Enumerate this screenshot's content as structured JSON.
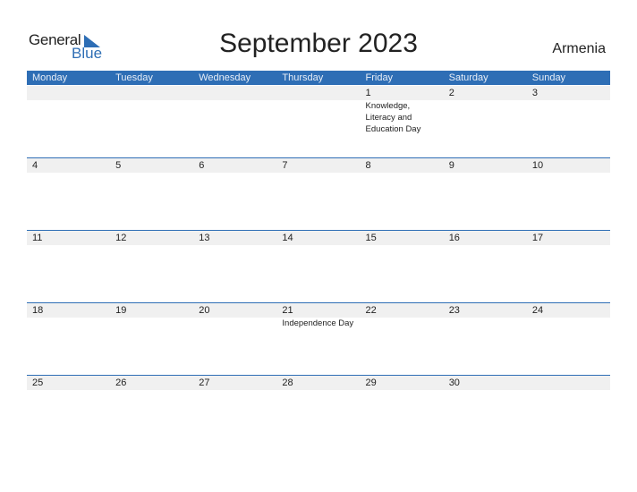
{
  "logo": {
    "general": "General",
    "blue": "Blue",
    "icon": "triangle-flag-icon"
  },
  "title": "September 2023",
  "country": "Armenia",
  "colors": {
    "accent": "#2e6eb5",
    "strip": "#f0f0f0"
  },
  "weekdays": [
    "Monday",
    "Tuesday",
    "Wednesday",
    "Thursday",
    "Friday",
    "Saturday",
    "Sunday"
  ],
  "weeks": [
    [
      {
        "day": ""
      },
      {
        "day": ""
      },
      {
        "day": ""
      },
      {
        "day": ""
      },
      {
        "day": "1",
        "holiday": "Knowledge, Literacy and Education Day"
      },
      {
        "day": "2"
      },
      {
        "day": "3"
      }
    ],
    [
      {
        "day": "4"
      },
      {
        "day": "5"
      },
      {
        "day": "6"
      },
      {
        "day": "7"
      },
      {
        "day": "8"
      },
      {
        "day": "9"
      },
      {
        "day": "10"
      }
    ],
    [
      {
        "day": "11"
      },
      {
        "day": "12"
      },
      {
        "day": "13"
      },
      {
        "day": "14"
      },
      {
        "day": "15"
      },
      {
        "day": "16"
      },
      {
        "day": "17"
      }
    ],
    [
      {
        "day": "18"
      },
      {
        "day": "19"
      },
      {
        "day": "20"
      },
      {
        "day": "21",
        "holiday": "Independence Day"
      },
      {
        "day": "22"
      },
      {
        "day": "23"
      },
      {
        "day": "24"
      }
    ],
    [
      {
        "day": "25"
      },
      {
        "day": "26"
      },
      {
        "day": "27"
      },
      {
        "day": "28"
      },
      {
        "day": "29"
      },
      {
        "day": "30"
      },
      {
        "day": ""
      }
    ]
  ]
}
